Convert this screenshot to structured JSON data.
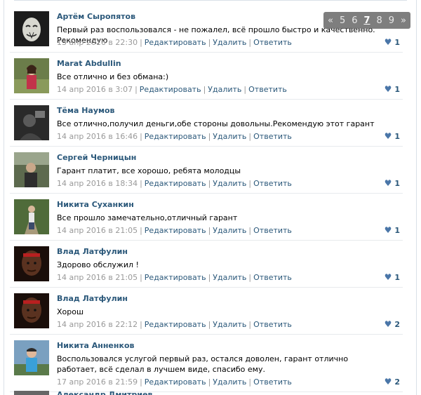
{
  "pager": {
    "prev": "«",
    "pages": [
      "5",
      "6",
      "7",
      "8",
      "9"
    ],
    "current": "7",
    "next": "»"
  },
  "actions": {
    "edit": "Редактировать",
    "delete": "Удалить",
    "reply": "Ответить",
    "sep": "|"
  },
  "posts": [
    {
      "author": "Артём Сыропятов",
      "text": "Первый раз воспользовался - не пожалел, всё прошло быстро и качественно. Рекомендую",
      "date": "13 апр 2016 в 22:30",
      "likes": "1",
      "avatar": "mask-avatar"
    },
    {
      "author": "Marat Abdullin",
      "text": "Все отлично и без обмана:)",
      "date": "14 апр 2016 в 3:07",
      "likes": "1",
      "avatar": "girl-avatar"
    },
    {
      "author": "Тёма Наумов",
      "text": "Все отлично,получил деньги,обе стороны довольны.Рекомендую этот гарант",
      "date": "14 апр 2016 в 16:46",
      "likes": "1",
      "avatar": "dark-avatar"
    },
    {
      "author": "Сергей Черницын",
      "text": "Гарант платит, все хорошо, ребята молодцы",
      "date": "14 апр 2016 в 18:34",
      "likes": "1",
      "avatar": "outdoor-avatar"
    },
    {
      "author": "Никита Суханкин",
      "text": "Все прошло замечательно,отличный гарант",
      "date": "14 апр 2016 в 21:05",
      "likes": "1",
      "avatar": "path-avatar"
    },
    {
      "author": "Влад Латфулин",
      "text": "Здорово обслужил !",
      "date": "14 апр 2016 в 21:05",
      "likes": "1",
      "avatar": "player-avatar"
    },
    {
      "author": "Влад Латфулин",
      "text": "Хорош",
      "date": "14 апр 2016 в 22:12",
      "likes": "2",
      "avatar": "player-avatar"
    },
    {
      "author": "Никита Анненков",
      "text": "Воспользовался услугой первый раз, остался доволен, гарант отлично работает, всё сделал в лучшем виде, спасибо ему.",
      "date": "17 апр 2016 в 21:59",
      "likes": "2",
      "avatar": "boy-avatar"
    }
  ],
  "partial_author": "Александр Дмитриев",
  "colors": {
    "link": "#2b587a",
    "meta": "#999999",
    "border": "#e7eaed"
  }
}
